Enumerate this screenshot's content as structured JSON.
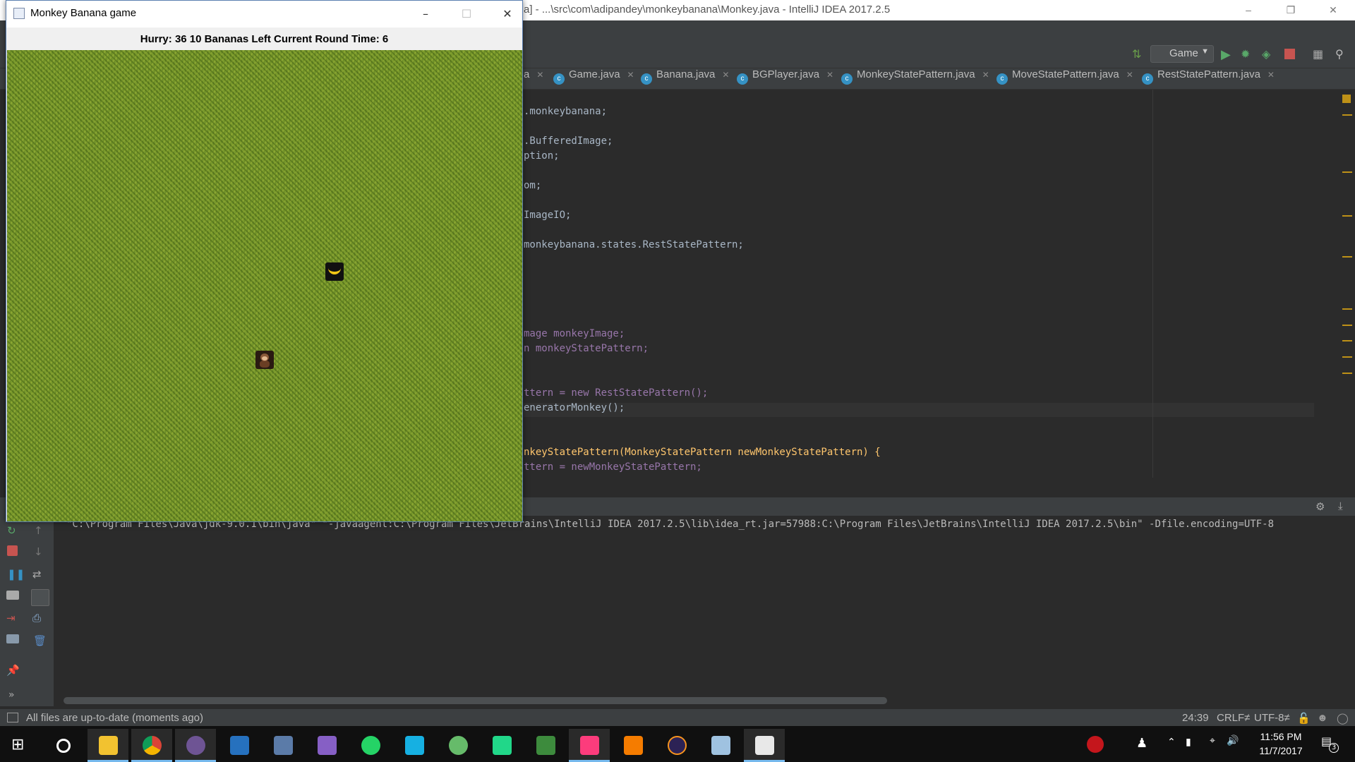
{
  "ide": {
    "title": "a] - ...\\src\\com\\adipandey\\monkeybanana\\Monkey.java - IntelliJ IDEA 2017.2.5",
    "run_config": "Game",
    "tabs": [
      {
        "label": "a"
      },
      {
        "label": "Game.java"
      },
      {
        "label": "Banana.java"
      },
      {
        "label": "BGPlayer.java"
      },
      {
        "label": "MonkeyStatePattern.java"
      },
      {
        "label": "MoveStatePattern.java"
      },
      {
        "label": "RestStatePattern.java"
      }
    ],
    "code_lines": [
      ".monkeybanana;",
      ".BufferedImage;",
      "ption;",
      "om;",
      "ImageIO;",
      "monkeybanana.states.RestStatePattern;",
      "mage monkeyImage;",
      "n monkeyStatePattern;",
      "ttern = new RestStatePattern();",
      "eneratorMonkey();",
      "nkeyStatePattern(MonkeyStatePattern newMonkeyStatePattern) {",
      "ttern = newMonkeyStatePattern;"
    ],
    "console_command": "\"C:\\Program Files\\Java\\jdk-9.0.1\\bin\\java\" \"-javaagent:C:\\Program Files\\JetBrains\\IntelliJ IDEA 2017.2.5\\lib\\idea_rt.jar=57988:C:\\Program Files\\JetBrains\\IntelliJ IDEA 2017.2.5\\bin\" -Dfile.encoding=UTF-8",
    "status": {
      "message": "All files are up-to-date (moments ago)",
      "position": "24:39",
      "line_sep": "CRLF≠",
      "encoding": "UTF-8≠"
    }
  },
  "game": {
    "window_title": "Monkey Banana game",
    "hud": "Hurry: 36  10 Bananas Left   Current Round Time: 6"
  },
  "taskbar": {
    "time": "11:56 PM",
    "date": "11/7/2017",
    "notifications": "3"
  },
  "colors": {
    "ide_bg": "#2b2b2b",
    "grass": "#7a9a2c",
    "taskbar_bg": "#101010"
  }
}
